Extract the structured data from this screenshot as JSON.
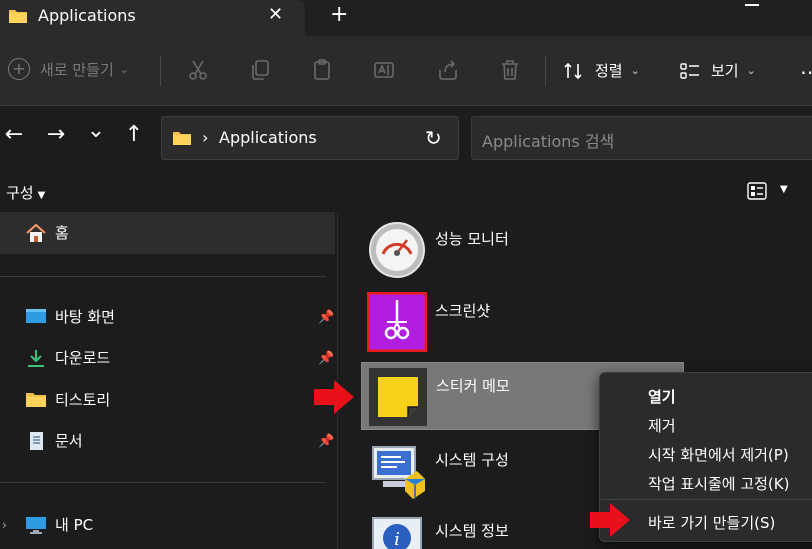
{
  "tab": {
    "title": "Applications",
    "close": "✕",
    "new_tab": "+"
  },
  "toolbar": {
    "new_label": "새로 만들기",
    "new_icon": "plus-circle-icon",
    "sort_label": "정렬",
    "view_label": "보기",
    "more": "⋯"
  },
  "address": {
    "back": "←",
    "forward": "→",
    "history": "⌄",
    "up": "↑",
    "path": "Applications",
    "refresh": "↻",
    "search_placeholder": "Applications 검색"
  },
  "command": {
    "organize_label": "구성"
  },
  "sidebar": {
    "home": "홈",
    "pinned": [
      {
        "label": "바탕 화면",
        "icon": "desktop-icon"
      },
      {
        "label": "다운로드",
        "icon": "download-icon"
      },
      {
        "label": "티스토리",
        "icon": "folder-icon"
      },
      {
        "label": "문서",
        "icon": "document-icon"
      }
    ],
    "this_pc": "내 PC"
  },
  "files": [
    {
      "name": "성능 모니터",
      "icon": "gauge-icon"
    },
    {
      "name": "스크린샷",
      "icon": "scissors-icon"
    },
    {
      "name": "스티커 메모",
      "icon": "sticky-note-icon",
      "selected": true
    },
    {
      "name": "시스템 구성",
      "icon": "system-config-icon"
    },
    {
      "name": "시스템 정보",
      "icon": "info-icon"
    }
  ],
  "context_menu": {
    "items": [
      {
        "label": "열기",
        "bold": true
      },
      {
        "label": "제거"
      },
      {
        "label": "시작 화면에서 제거(P)"
      },
      {
        "label": "작업 표시줄에 고정(K)"
      },
      {
        "label": "바로 가기 만들기(S)"
      }
    ]
  },
  "colors": {
    "accent_arrow": "#e8111a",
    "background": "#1c1c1c",
    "selection": "#787878",
    "sticky_yellow": "#f8d21a",
    "screenshot_purple": "#b21ee0"
  }
}
